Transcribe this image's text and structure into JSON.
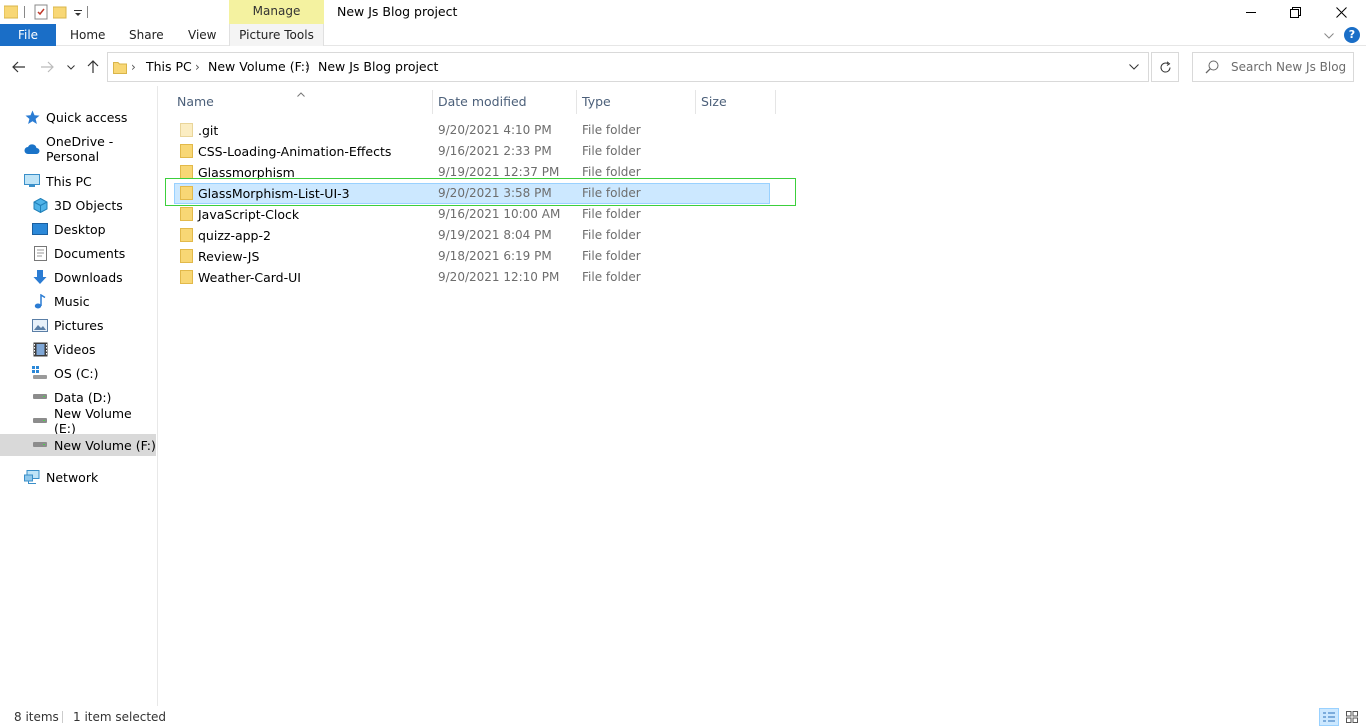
{
  "window": {
    "title": "New Js Blog project",
    "contextual_tab_group": "Manage"
  },
  "ribbon": {
    "file": "File",
    "tabs": [
      "Home",
      "Share",
      "View"
    ],
    "picture_tools": "Picture Tools"
  },
  "address": {
    "crumbs": [
      "This PC",
      "New Volume (F:)",
      "New Js Blog project"
    ]
  },
  "search": {
    "placeholder": "Search New Js Blog p..."
  },
  "navpane": {
    "quick_access": "Quick access",
    "onedrive": "OneDrive - Personal",
    "this_pc": "This PC",
    "items": [
      "3D Objects",
      "Desktop",
      "Documents",
      "Downloads",
      "Music",
      "Pictures",
      "Videos",
      "OS (C:)",
      "Data (D:)",
      "New Volume (E:)",
      "New Volume (F:)"
    ],
    "network": "Network"
  },
  "columns": {
    "name": "Name",
    "date": "Date modified",
    "type": "Type",
    "size": "Size"
  },
  "files": [
    {
      "name": ".git",
      "date": "9/20/2021 4:10 PM",
      "type": "File folder"
    },
    {
      "name": "CSS-Loading-Animation-Effects",
      "date": "9/16/2021 2:33 PM",
      "type": "File folder"
    },
    {
      "name": "Glassmorphism",
      "date": "9/19/2021 12:37 PM",
      "type": "File folder"
    },
    {
      "name": "GlassMorphism-List-UI-3",
      "date": "9/20/2021 3:58 PM",
      "type": "File folder"
    },
    {
      "name": "JavaScript-Clock",
      "date": "9/16/2021 10:00 AM",
      "type": "File folder"
    },
    {
      "name": "quizz-app-2",
      "date": "9/19/2021 8:04 PM",
      "type": "File folder"
    },
    {
      "name": "Review-JS",
      "date": "9/18/2021 6:19 PM",
      "type": "File folder"
    },
    {
      "name": "Weather-Card-UI",
      "date": "9/20/2021 12:10 PM",
      "type": "File folder"
    }
  ],
  "status": {
    "count": "8 items",
    "selected": "1 item selected"
  },
  "colors": {
    "file_tab": "#1a6ec7",
    "manage_tab": "#f4f2a0",
    "selection": "#cce8ff",
    "folder": "#f8d775",
    "highlight": "#3ccf3c"
  }
}
